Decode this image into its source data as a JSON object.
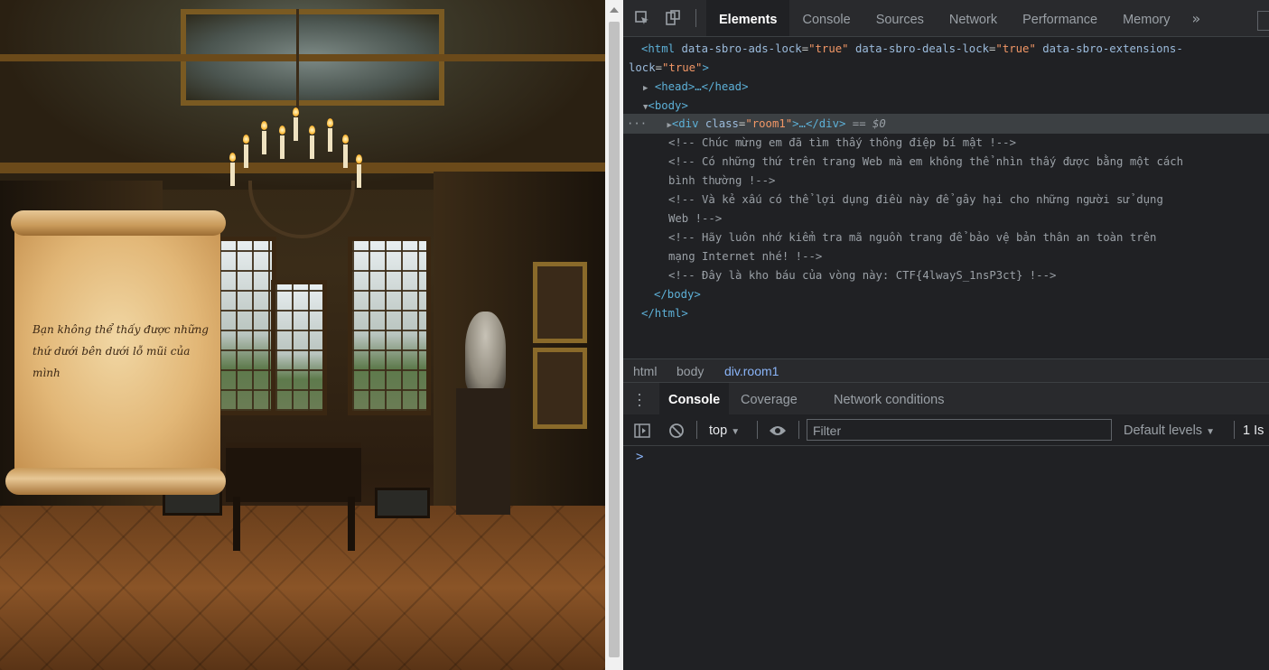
{
  "scroll": {
    "line1": "Bạn không thể thấy được những",
    "line2": "thứ dưới bên dưới lỗ mũi của mình"
  },
  "devtools": {
    "tabs": [
      "Elements",
      "Console",
      "Sources",
      "Network",
      "Performance",
      "Memory"
    ],
    "more_tabs": "»",
    "elements": {
      "html_open_tag": "html",
      "attr1_name": "data-sbro-ads-lock",
      "attr1_val": "\"true\"",
      "attr2_name": "data-sbro-deals-lock",
      "attr2_val": "\"true\"",
      "attr3_name_part1": "data-sbro-extensions-",
      "attr3_name_part2": "lock",
      "attr3_val": "\"true\"",
      "head": "<head>…</head>",
      "body_open": "<body>",
      "div_tag_open": "<div ",
      "div_class_attr": "class",
      "div_class_val": "\"room1\"",
      "div_tag_close": ">…</div>",
      "div_marker": "== $0",
      "ellipsis": "···",
      "comments": [
        "<!-- Chúc mừng em đã tìm thấy thông điệp bí mật !-->",
        "<!-- Có những thứ trên trang Web mà em không thể nhìn thấy được bằng một cách",
        "bình thường !-->",
        "<!-- Và kẻ xấu có thể lợi dụng điều này để gây hại cho những người sử dụng",
        "Web !-->",
        "<!-- Hãy luôn nhớ kiểm tra mã nguồn trang để bảo vệ bản thân an toàn trên",
        "mạng Internet nhé! !-->",
        "<!-- Đây là kho báu của vòng này: CTF{4lwayS_1nsP3ct} !-->"
      ],
      "body_close": "</body>",
      "html_close": "</html>"
    },
    "breadcrumbs": [
      "html",
      "body",
      "div.room1"
    ],
    "drawer_tabs": [
      "Console",
      "Coverage",
      "Network conditions"
    ],
    "console": {
      "context": "top",
      "filter_placeholder": "Filter",
      "levels": "Default levels",
      "issues": "1 Is",
      "prompt": ">"
    }
  }
}
